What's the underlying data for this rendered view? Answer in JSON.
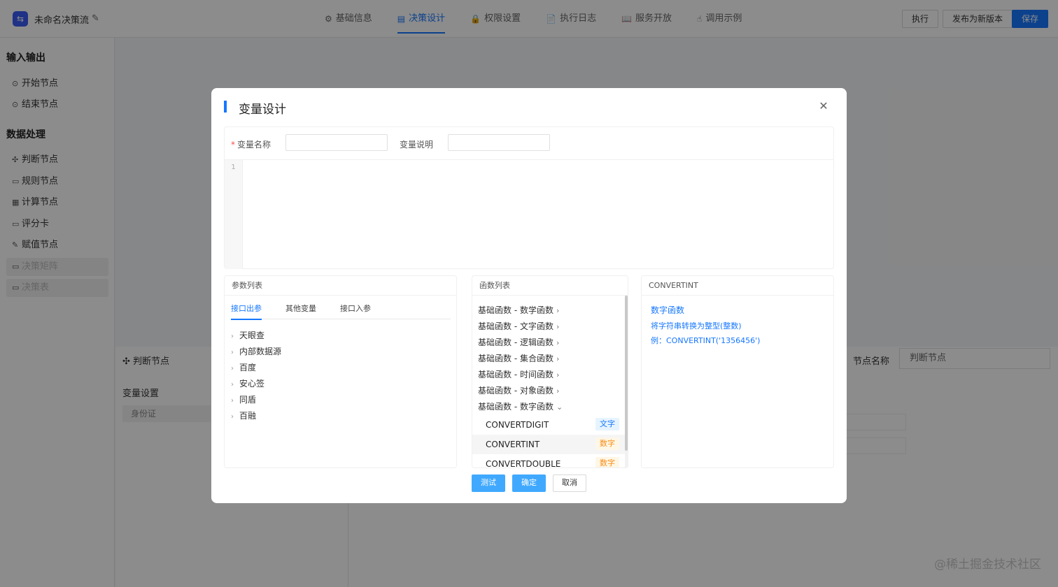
{
  "app": {
    "title": "未命名决策流",
    "nav_tabs": [
      {
        "label": "基础信息",
        "icon": "gear-icon",
        "glyph": "⚙"
      },
      {
        "label": "决策设计",
        "icon": "design-icon",
        "glyph": "▤"
      },
      {
        "label": "权限设置",
        "icon": "lock-icon",
        "glyph": "🔒"
      },
      {
        "label": "执行日志",
        "icon": "document-icon",
        "glyph": "📄"
      },
      {
        "label": "服务开放",
        "icon": "book-icon",
        "glyph": "📖"
      },
      {
        "label": "调用示例",
        "icon": "hand-icon",
        "glyph": "☝"
      }
    ],
    "buttons": {
      "execute": "执行",
      "publish": "发布为新版本",
      "save": "保存"
    }
  },
  "sidebar": {
    "groups": [
      {
        "title": "输入输出",
        "items": [
          {
            "label": "开始节点",
            "glyph": "⊙",
            "icon": "start-node-icon",
            "disabled": false
          },
          {
            "label": "结束节点",
            "glyph": "⊙",
            "icon": "end-node-icon",
            "disabled": false
          }
        ]
      },
      {
        "title": "数据处理",
        "items": [
          {
            "label": "判断节点",
            "glyph": "✣",
            "icon": "judge-node-icon",
            "disabled": false
          },
          {
            "label": "规则节点",
            "glyph": "▭",
            "icon": "rule-node-icon",
            "disabled": false
          },
          {
            "label": "计算节点",
            "glyph": "▦",
            "icon": "calc-node-icon",
            "disabled": false
          },
          {
            "label": "评分卡",
            "glyph": "▭",
            "icon": "scorecard-icon",
            "disabled": false
          },
          {
            "label": "赋值节点",
            "glyph": "✎",
            "icon": "assign-node-icon",
            "disabled": false
          },
          {
            "label": "决策矩阵",
            "glyph": "▭",
            "icon": "matrix-icon",
            "disabled": true
          },
          {
            "label": "决策表",
            "glyph": "▭",
            "icon": "table-icon",
            "disabled": true
          }
        ]
      }
    ]
  },
  "bottom_panel": {
    "title": "判断节点",
    "variable_settings": "变量设置",
    "id_field": "身份证",
    "node_name_label": "节点名称",
    "node_name_value": "判断节点"
  },
  "watermark": "@稀土掘金技术社区",
  "modal": {
    "title": "变量设计",
    "close_glyph": "✕",
    "var_name_label": "变量名称",
    "var_name_value": "",
    "var_desc_label": "变量说明",
    "var_desc_value": "",
    "line_number": "1",
    "params": {
      "header": "参数列表",
      "tabs": [
        "接口出参",
        "其他变量",
        "接口入参"
      ],
      "tree": [
        "天眼查",
        "内部数据源",
        "百度",
        "安心签",
        "同盾",
        "百融"
      ]
    },
    "functions": {
      "header": "函数列表",
      "groups": [
        {
          "label": "基础函数 - 数学函数",
          "chev": "›"
        },
        {
          "label": "基础函数 - 文字函数",
          "chev": "›"
        },
        {
          "label": "基础函数 - 逻辑函数",
          "chev": "›"
        },
        {
          "label": "基础函数 - 集合函数",
          "chev": "›"
        },
        {
          "label": "基础函数 - 时间函数",
          "chev": "›"
        },
        {
          "label": "基础函数 - 对象函数",
          "chev": "›"
        },
        {
          "label": "基础函数 - 数字函数",
          "chev": "⌄"
        }
      ],
      "items": [
        {
          "name": "CONVERTDIGIT",
          "type": "文字",
          "kind": "text"
        },
        {
          "name": "CONVERTINT",
          "type": "数字",
          "kind": "num"
        },
        {
          "name": "CONVERTDOUBLE",
          "type": "数字",
          "kind": "num"
        }
      ]
    },
    "detail": {
      "header": "CONVERTINT",
      "category": "数字函数",
      "description": "将字符串转换为整型(整数)",
      "example": "例：CONVERTINT('1356456')"
    },
    "buttons": {
      "test": "测试",
      "confirm": "确定",
      "cancel": "取消"
    }
  }
}
